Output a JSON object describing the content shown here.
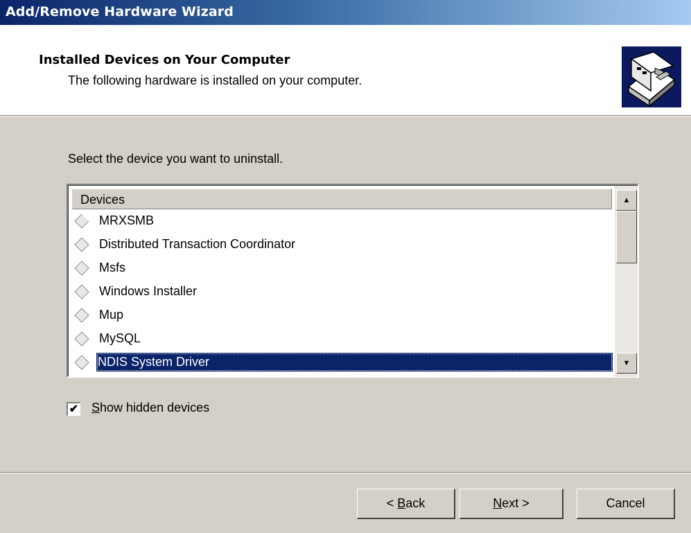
{
  "window": {
    "title": "Add/Remove Hardware Wizard"
  },
  "header": {
    "heading": "Installed Devices on Your Computer",
    "subheading": "The following hardware is installed on your computer."
  },
  "prompt": "Select the device you want to uninstall.",
  "devices_list": {
    "column_header": "Devices",
    "items": [
      {
        "label": "MRXSMB",
        "icon": "device-diamond-icon",
        "selected": false
      },
      {
        "label": "Distributed Transaction Coordinator",
        "icon": "device-diamond-icon",
        "selected": false
      },
      {
        "label": "Msfs",
        "icon": "device-diamond-icon",
        "selected": false
      },
      {
        "label": "Windows Installer",
        "icon": "device-diamond-icon",
        "selected": false
      },
      {
        "label": "Mup",
        "icon": "device-diamond-icon",
        "selected": false
      },
      {
        "label": "MySQL",
        "icon": "device-diamond-icon",
        "selected": false
      },
      {
        "label": "NDIS System Driver",
        "icon": "device-diamond-icon",
        "selected": true
      }
    ]
  },
  "show_hidden": {
    "label_underlined": "S",
    "label_rest": "how hidden devices",
    "checked": true,
    "check_mark": "✔"
  },
  "buttons": {
    "back_prefix": "< ",
    "back_underlined": "B",
    "back_rest": "ack",
    "next_underlined": "N",
    "next_rest": "ext >",
    "cancel": "Cancel"
  },
  "colors": {
    "title_start": "#0a246a",
    "title_end": "#a6caf0",
    "dialog_face": "#d4d0c8",
    "selection": "#0a246a"
  }
}
